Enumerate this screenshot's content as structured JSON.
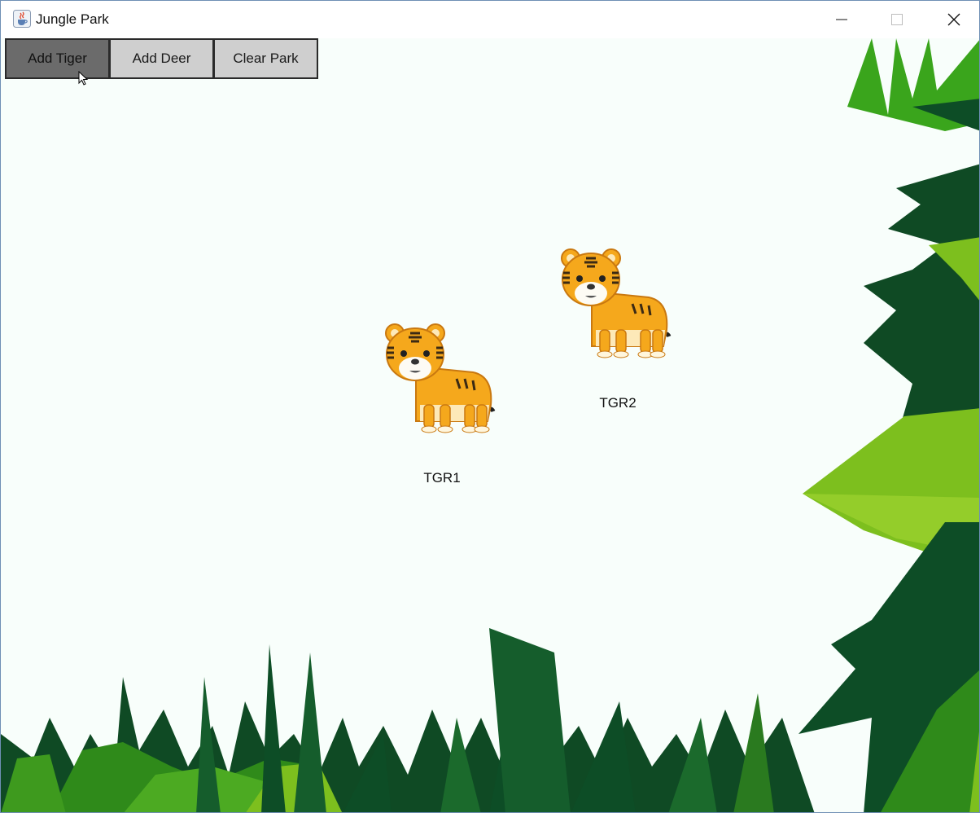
{
  "window": {
    "title": "Jungle Park",
    "controls": [
      "minimize",
      "maximize",
      "close"
    ]
  },
  "toolbar": {
    "buttons": [
      {
        "label": "Add Tiger",
        "state": "pressed"
      },
      {
        "label": "Add Deer",
        "state": "normal"
      },
      {
        "label": "Clear Park",
        "state": "normal"
      }
    ]
  },
  "animals": [
    {
      "label": "TGR1",
      "icon": "tiger-icon"
    },
    {
      "label": "TGR2",
      "icon": "tiger-icon"
    }
  ],
  "colors": {
    "background": "#f8fefb",
    "button": "#cfcfcf",
    "button_pressed": "#6b6b6b",
    "tiger_orange": "#f5a81c",
    "leaf_dark": "#0d4d26",
    "leaf_light": "#7dbf1e"
  }
}
